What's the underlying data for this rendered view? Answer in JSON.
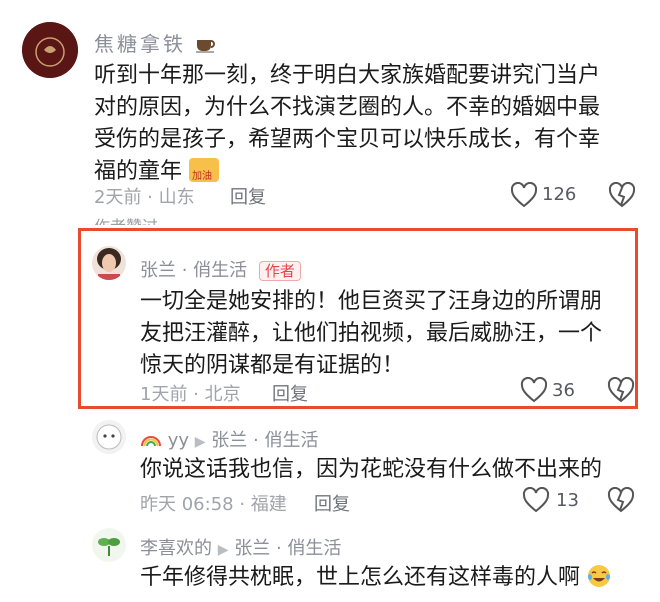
{
  "comments": [
    {
      "username": "焦糖拿铁",
      "text_lines": [
        "听到十年那一刻，终于明白大家族婚配要讲究门当户",
        "对的原因，为什么不找演艺圈的人。不幸的婚姻中最",
        "受伤的是孩子，希望两个宝贝可以快乐成长，有个幸",
        "福的童年"
      ],
      "emoji_badge": "加油",
      "time_location": "2天前 · 山东",
      "reply": "回复",
      "likes": "126"
    },
    {
      "cutoff_text": "作者赞过",
      "username": "张兰 · 俏生活",
      "author_tag": "作者",
      "text_lines": [
        "一切全是她安排的！他巨资买了汪身边的所谓朋",
        "友把汪灌醉，让他们拍视频，最后威胁汪，一个",
        "惊天的阴谋都是有证据的！"
      ],
      "time_location": "1天前 · 北京",
      "reply": "回复",
      "likes": "36"
    },
    {
      "username": "yy",
      "reply_to": "张兰 · 俏生活",
      "text": "你说这话我也信，因为花蛇没有什么做不出来的",
      "time_location": "昨天 06:58 · 福建",
      "reply": "回复",
      "likes": "13"
    },
    {
      "username": "李喜欢的",
      "reply_to": "张兰 · 俏生活",
      "text": "千年修得共枕眠，世上怎么还有这样毒的人啊"
    }
  ],
  "colors": {
    "highlight": "#e94b2f",
    "author_tag": "#e04848"
  }
}
